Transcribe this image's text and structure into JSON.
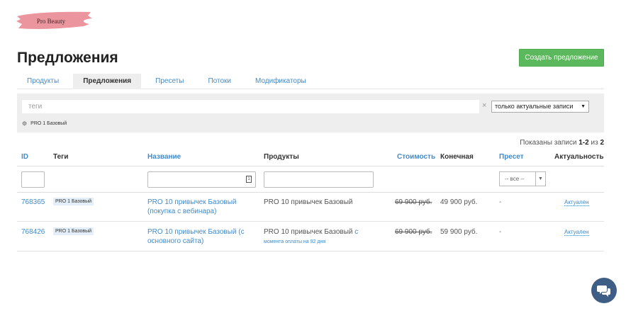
{
  "logo": {
    "text": "Pro Beauty"
  },
  "page": {
    "title": "Предложения"
  },
  "actions": {
    "create_label": "Создать предложение"
  },
  "tabs": [
    {
      "label": "Продукты",
      "active": false
    },
    {
      "label": "Предложения",
      "active": true
    },
    {
      "label": "Пресеты",
      "active": false
    },
    {
      "label": "Потоки",
      "active": false
    },
    {
      "label": "Модификаторы",
      "active": false
    }
  ],
  "filters": {
    "tags_placeholder": "теги",
    "clear_symbol": "×",
    "records_select": "только актуальные записи",
    "selected_tag": "PRO 1 Базовый"
  },
  "pagination": {
    "shown_prefix": "Показаны записи",
    "range": "1-2",
    "of": "из",
    "total": "2"
  },
  "table": {
    "columns": {
      "id": "ID",
      "tags": "Теги",
      "name": "Название",
      "products": "Продукты",
      "cost": "Стоимость",
      "final": "Конечная",
      "preset": "Пресет",
      "actual": "Актуальность"
    },
    "preset_filter": "-- все --",
    "rows": [
      {
        "id": "768365",
        "tag": "PRO 1 Базовый",
        "name_line1": "PRO 10 привычек Базовый",
        "name_line2": "(покупка с вебинара)",
        "product": "PRO 10 привычек Базовый",
        "product_tail": "",
        "product_sub": "",
        "old_price": "69 900 руб.",
        "final_price": "49 900 руб.",
        "preset": "-",
        "actual": "Актуален"
      },
      {
        "id": "768426",
        "tag": "PRO 1 Базовый",
        "name_line1": "PRO 10 привычек Базовый (с",
        "name_line2": "основного сайта)",
        "product": "PRO 10 привычек Базовый",
        "product_tail": " с",
        "product_sub": "момента оплаты на 92 дня",
        "old_price": "69 900 руб.",
        "final_price": "59 900 руб.",
        "preset": "-",
        "actual": "Актуален"
      }
    ]
  },
  "colors": {
    "accent": "#428bca",
    "success": "#5cb85c",
    "chat": "#3f5e85"
  }
}
